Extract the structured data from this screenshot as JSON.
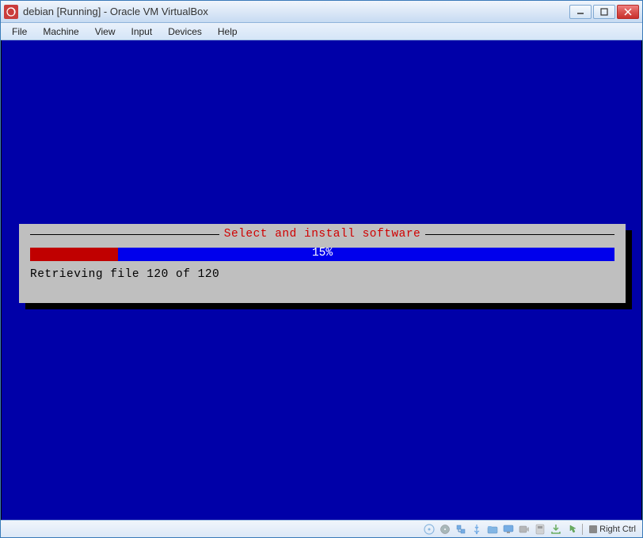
{
  "window": {
    "title": "debian [Running] - Oracle VM VirtualBox"
  },
  "menu": {
    "items": [
      "File",
      "Machine",
      "View",
      "Input",
      "Devices",
      "Help"
    ]
  },
  "installer": {
    "dialog_title": "Select and install software",
    "progress_percent": 15,
    "progress_label": "15%",
    "status": "Retrieving file 120 of 120",
    "colors": {
      "background": "#0000a8",
      "dialog_bg": "#bfbfbf",
      "progress_fill": "#c00000",
      "progress_bg": "#0000ec",
      "title_color": "#d00000"
    }
  },
  "statusbar": {
    "host_key": "Right Ctrl",
    "icons": [
      "disc",
      "hdd",
      "network",
      "usb",
      "shared-folder",
      "display",
      "recording",
      "audio",
      "clipboard",
      "mouse-integration"
    ]
  }
}
